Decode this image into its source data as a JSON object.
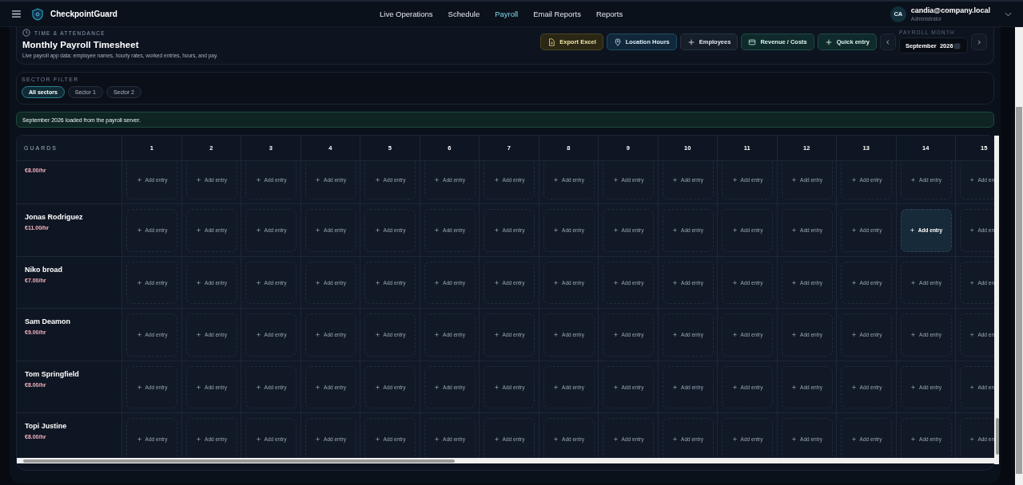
{
  "app": {
    "brand": "CheckpointGuard"
  },
  "nav": [
    {
      "label": "Live Operations",
      "selected": false
    },
    {
      "label": "Schedule",
      "selected": false
    },
    {
      "label": "Payroll",
      "selected": true
    },
    {
      "label": "Email Reports",
      "selected": false
    },
    {
      "label": "Reports",
      "selected": false
    }
  ],
  "user": {
    "initials": "CA",
    "email": "candia@company.local",
    "role": "Administrator"
  },
  "header_card": {
    "eyebrow": "TIME & ATTENDANCE",
    "title": "Monthly Payroll Timesheet",
    "subtitle": "Live payroll app data: employee names, hourly rates, worked entries, hours, and pay.",
    "actions": [
      {
        "label": "Export Excel",
        "kind": "export"
      },
      {
        "label": "Location Hours",
        "kind": "location"
      },
      {
        "label": "Employees",
        "kind": "add"
      },
      {
        "label": "Revenue / Costs",
        "kind": "revenue"
      },
      {
        "label": "Quick entry",
        "kind": "quick"
      }
    ],
    "month": {
      "label": "PAYROLL MONTH",
      "value": "September  2026"
    }
  },
  "sector_filter": {
    "label": "SECTOR FILTER",
    "options": [
      {
        "label": "All sectors",
        "selected": true
      },
      {
        "label": "Sector 1",
        "selected": false
      },
      {
        "label": "Sector 2",
        "selected": false
      }
    ]
  },
  "notice": "September 2026 loaded from the payroll server.",
  "timesheet": {
    "corner": "GUARDS",
    "days": [
      "1",
      "2",
      "3",
      "4",
      "5",
      "6",
      "7",
      "8",
      "9",
      "10",
      "11",
      "12",
      "13",
      "14",
      "15"
    ],
    "rows": [
      {
        "rate": "€8.00/hr",
        "cells": [
          {
            "label": "Add entry",
            "hovered": false
          },
          {
            "label": "Add entry",
            "hovered": false
          },
          {
            "label": "Add entry",
            "hovered": false
          },
          {
            "label": "Add entry",
            "hovered": false
          },
          {
            "label": "Add entry",
            "hovered": false
          },
          {
            "label": "Add entry",
            "hovered": false
          },
          {
            "label": "Add entry",
            "hovered": false
          },
          {
            "label": "Add entry",
            "hovered": false
          },
          {
            "label": "Add entry",
            "hovered": false
          },
          {
            "label": "Add entry",
            "hovered": false
          },
          {
            "label": "Add entry",
            "hovered": false
          },
          {
            "label": "Add entry",
            "hovered": false
          },
          {
            "label": "Add entry",
            "hovered": false
          },
          {
            "label": "Add entry",
            "hovered": false
          },
          {
            "label": "Add en",
            "hovered": false
          }
        ]
      },
      {
        "name": "Jonas Rodriguez",
        "rate": "€11.00/hr",
        "cells": [
          {
            "label": "Add entry",
            "hovered": false
          },
          {
            "label": "Add entry",
            "hovered": false
          },
          {
            "label": "Add entry",
            "hovered": false
          },
          {
            "label": "Add entry",
            "hovered": false
          },
          {
            "label": "Add entry",
            "hovered": false
          },
          {
            "label": "Add entry",
            "hovered": false
          },
          {
            "label": "Add entry",
            "hovered": false
          },
          {
            "label": "Add entry",
            "hovered": false
          },
          {
            "label": "Add entry",
            "hovered": false
          },
          {
            "label": "Add entry",
            "hovered": false
          },
          {
            "label": "Add entry",
            "hovered": false
          },
          {
            "label": "Add entry",
            "hovered": false
          },
          {
            "label": "Add entry",
            "hovered": false
          },
          {
            "label": "Add entry",
            "hovered": true
          },
          {
            "label": "Add en",
            "hovered": false
          }
        ]
      },
      {
        "name": "Niko broad",
        "rate": "€7.00/hr",
        "cells": [
          {
            "label": "Add entry",
            "hovered": false
          },
          {
            "label": "Add entry",
            "hovered": false
          },
          {
            "label": "Add entry",
            "hovered": false
          },
          {
            "label": "Add entry",
            "hovered": false
          },
          {
            "label": "Add entry",
            "hovered": false
          },
          {
            "label": "Add entry",
            "hovered": false
          },
          {
            "label": "Add entry",
            "hovered": false
          },
          {
            "label": "Add entry",
            "hovered": false
          },
          {
            "label": "Add entry",
            "hovered": false
          },
          {
            "label": "Add entry",
            "hovered": false
          },
          {
            "label": "Add entry",
            "hovered": false
          },
          {
            "label": "Add entry",
            "hovered": false
          },
          {
            "label": "Add entry",
            "hovered": false
          },
          {
            "label": "Add entry",
            "hovered": false
          },
          {
            "label": "Add en",
            "hovered": false
          }
        ]
      },
      {
        "name": "Sam Deamon",
        "rate": "€9.00/hr",
        "cells": [
          {
            "label": "Add entry",
            "hovered": false
          },
          {
            "label": "Add entry",
            "hovered": false
          },
          {
            "label": "Add entry",
            "hovered": false
          },
          {
            "label": "Add entry",
            "hovered": false
          },
          {
            "label": "Add entry",
            "hovered": false
          },
          {
            "label": "Add entry",
            "hovered": false
          },
          {
            "label": "Add entry",
            "hovered": false
          },
          {
            "label": "Add entry",
            "hovered": false
          },
          {
            "label": "Add entry",
            "hovered": false
          },
          {
            "label": "Add entry",
            "hovered": false
          },
          {
            "label": "Add entry",
            "hovered": false
          },
          {
            "label": "Add entry",
            "hovered": false
          },
          {
            "label": "Add entry",
            "hovered": false
          },
          {
            "label": "Add entry",
            "hovered": false
          },
          {
            "label": "Add en",
            "hovered": false
          }
        ]
      },
      {
        "name": "Tom Springfield",
        "rate": "€8.00/hr",
        "cells": [
          {
            "label": "Add entry",
            "hovered": false
          },
          {
            "label": "Add entry",
            "hovered": false
          },
          {
            "label": "Add entry",
            "hovered": false
          },
          {
            "label": "Add entry",
            "hovered": false
          },
          {
            "label": "Add entry",
            "hovered": false
          },
          {
            "label": "Add entry",
            "hovered": false
          },
          {
            "label": "Add entry",
            "hovered": false
          },
          {
            "label": "Add entry",
            "hovered": false
          },
          {
            "label": "Add entry",
            "hovered": false
          },
          {
            "label": "Add entry",
            "hovered": false
          },
          {
            "label": "Add entry",
            "hovered": false
          },
          {
            "label": "Add entry",
            "hovered": false
          },
          {
            "label": "Add entry",
            "hovered": false
          },
          {
            "label": "Add entry",
            "hovered": false
          },
          {
            "label": "Add en",
            "hovered": false
          }
        ]
      },
      {
        "name": "Topi Justine",
        "rate": "€8.00/hr",
        "cells": [
          {
            "label": "Add entry",
            "hovered": false
          },
          {
            "label": "Add entry",
            "hovered": false
          },
          {
            "label": "Add entry",
            "hovered": false
          },
          {
            "label": "Add entry",
            "hovered": false
          },
          {
            "label": "Add entry",
            "hovered": false
          },
          {
            "label": "Add entry",
            "hovered": false
          },
          {
            "label": "Add entry",
            "hovered": false
          },
          {
            "label": "Add entry",
            "hovered": false
          },
          {
            "label": "Add entry",
            "hovered": false
          },
          {
            "label": "Add entry",
            "hovered": false
          },
          {
            "label": "Add entry",
            "hovered": false
          },
          {
            "label": "Add entry",
            "hovered": false
          },
          {
            "label": "Add entry",
            "hovered": false
          },
          {
            "label": "Add entry",
            "hovered": false
          },
          {
            "label": "Add en",
            "hovered": false
          }
        ]
      }
    ]
  }
}
